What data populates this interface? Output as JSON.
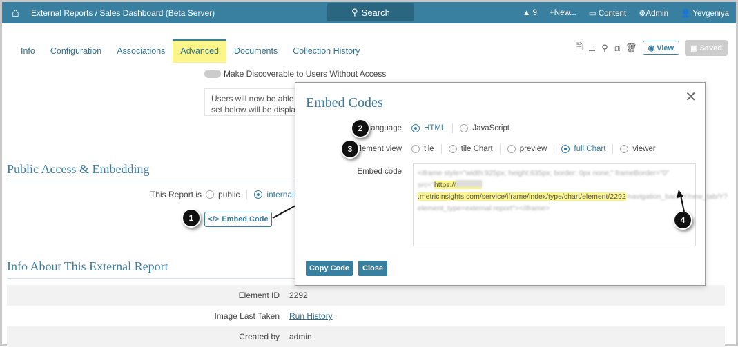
{
  "topbar": {
    "breadcrumb": "External Reports / Sales Dashboard (Beta Server)",
    "search": "Search",
    "alerts": "9",
    "new": "New...",
    "content": "Content",
    "admin": "Admin",
    "user": "Yevgeniya"
  },
  "tabs": [
    "Info",
    "Configuration",
    "Associations",
    "Advanced",
    "Documents",
    "Collection History"
  ],
  "toolbar": {
    "view": "View",
    "saved": "Saved"
  },
  "discoverable": "Make Discoverable to Users Without Access",
  "note": [
    "Users will now be able to",
    "set below will be display"
  ],
  "public_section": {
    "title": "Public Access & Embedding",
    "report_is": "This Report is",
    "public": "public",
    "internal": "internal",
    "embed_btn": "Embed Code"
  },
  "info_section": {
    "title": "Info About This External Report",
    "rows": [
      {
        "k": "Element ID",
        "v": "2292"
      },
      {
        "k": "Image Last Taken",
        "v": "Run History"
      },
      {
        "k": "Created by",
        "v": "admin"
      }
    ]
  },
  "modal": {
    "title": "Embed Codes",
    "language_label": "Language",
    "languages": [
      "HTML",
      "JavaScript"
    ],
    "element_view_label": "Element view",
    "views": [
      "tile",
      "tile Chart",
      "preview",
      "full Chart",
      "viewer"
    ],
    "embed_code_label": "Embed code",
    "code_pre": "<iframe style=\"width:925px; height:635px; border: 0px none;\" frameBorder=\"0\" src=\"",
    "code_hl1": "https://",
    "code_hl2": ".metricinsights.com/service/iframe/index/type/chart/element/22",
    "code_hl3": "92",
    "code_post": "/navigation_back/Y/new_tab/Y?element_type=external report\"></iframe>",
    "copy": "Copy Code",
    "close": "Close"
  },
  "badges": [
    "1",
    "2",
    "3",
    "4"
  ]
}
